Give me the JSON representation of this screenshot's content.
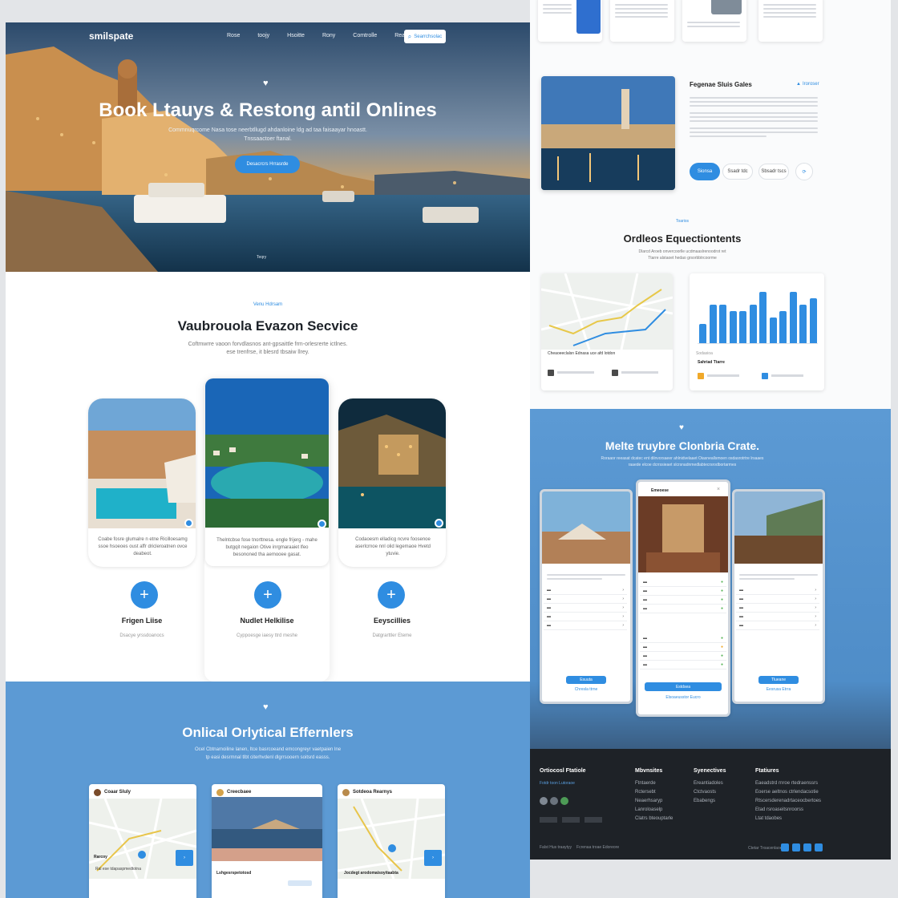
{
  "brand": "smilspate",
  "nav": [
    "Rose",
    "toojy",
    "Hsoitte",
    "Rony",
    "Comtrolle",
    "Rearst"
  ],
  "nav_cta": "Searrchsolac",
  "hero": {
    "title": "Book Ltauys & Restong antil Onlines",
    "subtitle_1": "Commnuqrcome Nasa tose neerbtllugd ahdanloine ldg ad taa faisaayar hnoastt.",
    "subtitle_2": "Tnssaactoer ftanal.",
    "button": "Desacrcrs Hrrasrde",
    "caption": "Teqry"
  },
  "services": {
    "eyebrow": "Venu Hdrsam",
    "title": "Vaubrouola Evazon Secvice",
    "desc_1": "Coftmwrre vaoon forvdlasnos ant-gpsaittle frm-orlesrerte ictlnes.",
    "desc_2": "ese trenfrse, it blesrd tbsaiw llrey.",
    "items": [
      {
        "text": "Coabe fosre glumalre n etne Ricilloesamg ssoe hsoeoes oust affr dricleroatnen ovce deabeot.",
        "label": "Frigen Liise",
        "sub": "Dsacye yrssdoanocs"
      },
      {
        "text": "Thelntcbse fose tnorttnesa. engle frijerg - mahe butgqit negaion Otive inrgmaraaiet lfeo besononed tha aemooee gasat.",
        "label": "Nudlet Helkilise",
        "sub": "Cyppoesge iaesy ttrd meshe"
      },
      {
        "text": "Codaoesm elladicg ncvre foosenoe aserlcrnoe nnl olid legemaoe Hvetd ytuvie.",
        "label": "Eeyscillies",
        "sub": "Datgrarttler Eteme"
      }
    ]
  },
  "offers": {
    "title": "Onlical Orlytical Effernlers",
    "desc_1": "Ocel Cbtnamoiline lanen, Itce basrcoeand emcongreyr vaetpaien lne",
    "desc_2": "tp easi desrmnal tlbt citerhvdenl dlgrrsooern soitsrd easss.",
    "cards": [
      {
        "title": "Coaar Sluly",
        "label": "Rarcoy",
        "line": "Ral ese tdapaspmedtotna"
      },
      {
        "title": "Creecbaee",
        "label": "Lshgesrspetotosd",
        "line": ""
      },
      {
        "title": "Sotdeoa Rearnys",
        "label": "Jocdegt arodomaisoyitaabta",
        "line": ""
      }
    ]
  },
  "right_top": {
    "heading": "Fegenae Sluis Gales",
    "link": "Iroroser",
    "buttons": [
      "Sionsa",
      "Ssadr tdc",
      "Sbsadr tscs"
    ]
  },
  "overview": {
    "eyebrow": "Toarios",
    "title": "Ordleos Equectiontents",
    "desc_1": "Dlarcd Aroeb onvercoorlle ucdmaaslrenoodrot ret",
    "desc_2": "Ttarre alstaoet hedao grsorbbtrcoorme",
    "map_caption": "Cheaoeeclalsn Ednasa uce afd lotdon",
    "stats_label": "Sodasioa",
    "stats_title": "Sahriad Ttarre",
    "chart_data": {
      "type": "bar",
      "values": [
        3,
        6,
        6,
        5,
        5,
        6,
        8,
        4,
        5,
        8,
        6,
        7
      ]
    }
  },
  "mobile": {
    "title": "Melte truybre Clonbria Crate.",
    "desc_1": "Roraaor reeasat dcatec ent dilnvorsaeer ahlnidvelaaet Oiasneallsmoen osdasrotrtre lrsaaes",
    "desc_2": "raaede elcoe dcrrssieaet slcrsnadnmedlabtecrsrodbortarmes",
    "phones": [
      {
        "header": "",
        "button": "Esuuta",
        "link": "Chresla ttrne"
      },
      {
        "header": "Emeoese",
        "button": "Estdsea",
        "link": "Elsoaeusstor Eucro"
      },
      {
        "header": "",
        "button": "Tlueane",
        "link": "Eesrusa Etrra"
      }
    ]
  },
  "footer": {
    "col1": "Ortiocosl Ftatiole",
    "col1_line": "Fotdr toon Lutoraoe",
    "col2": "Mbvnsites",
    "col2_items": [
      "Ftntaerde",
      "Rctersebt",
      "Neaerhsaryp",
      "Lanroloaselp",
      "Clatrs bteouptarle"
    ],
    "col3": "Syenectives",
    "col3_items": [
      "Ereantiadoles",
      "Ctctvaosts",
      "Ebabengs"
    ],
    "col4": "Ftatiures",
    "col4_items": [
      "Eaeadstrd rnroe rtedraenssrs",
      "Eoerse aeltnos ctrlendacsotie",
      "Rtscersderenadrtaceocbertoes",
      "Etad rsroaseitsnroorss",
      "Ltat tdaobes"
    ],
    "copyright": "Falst Hus traaytyy",
    "links": "Fcrenaa troae Edoreore",
    "right": "Ctetar Troacenlaoe"
  },
  "colors": {
    "accent": "#2f8de1",
    "band": "#5c9ad4",
    "footer": "#1e2227"
  }
}
